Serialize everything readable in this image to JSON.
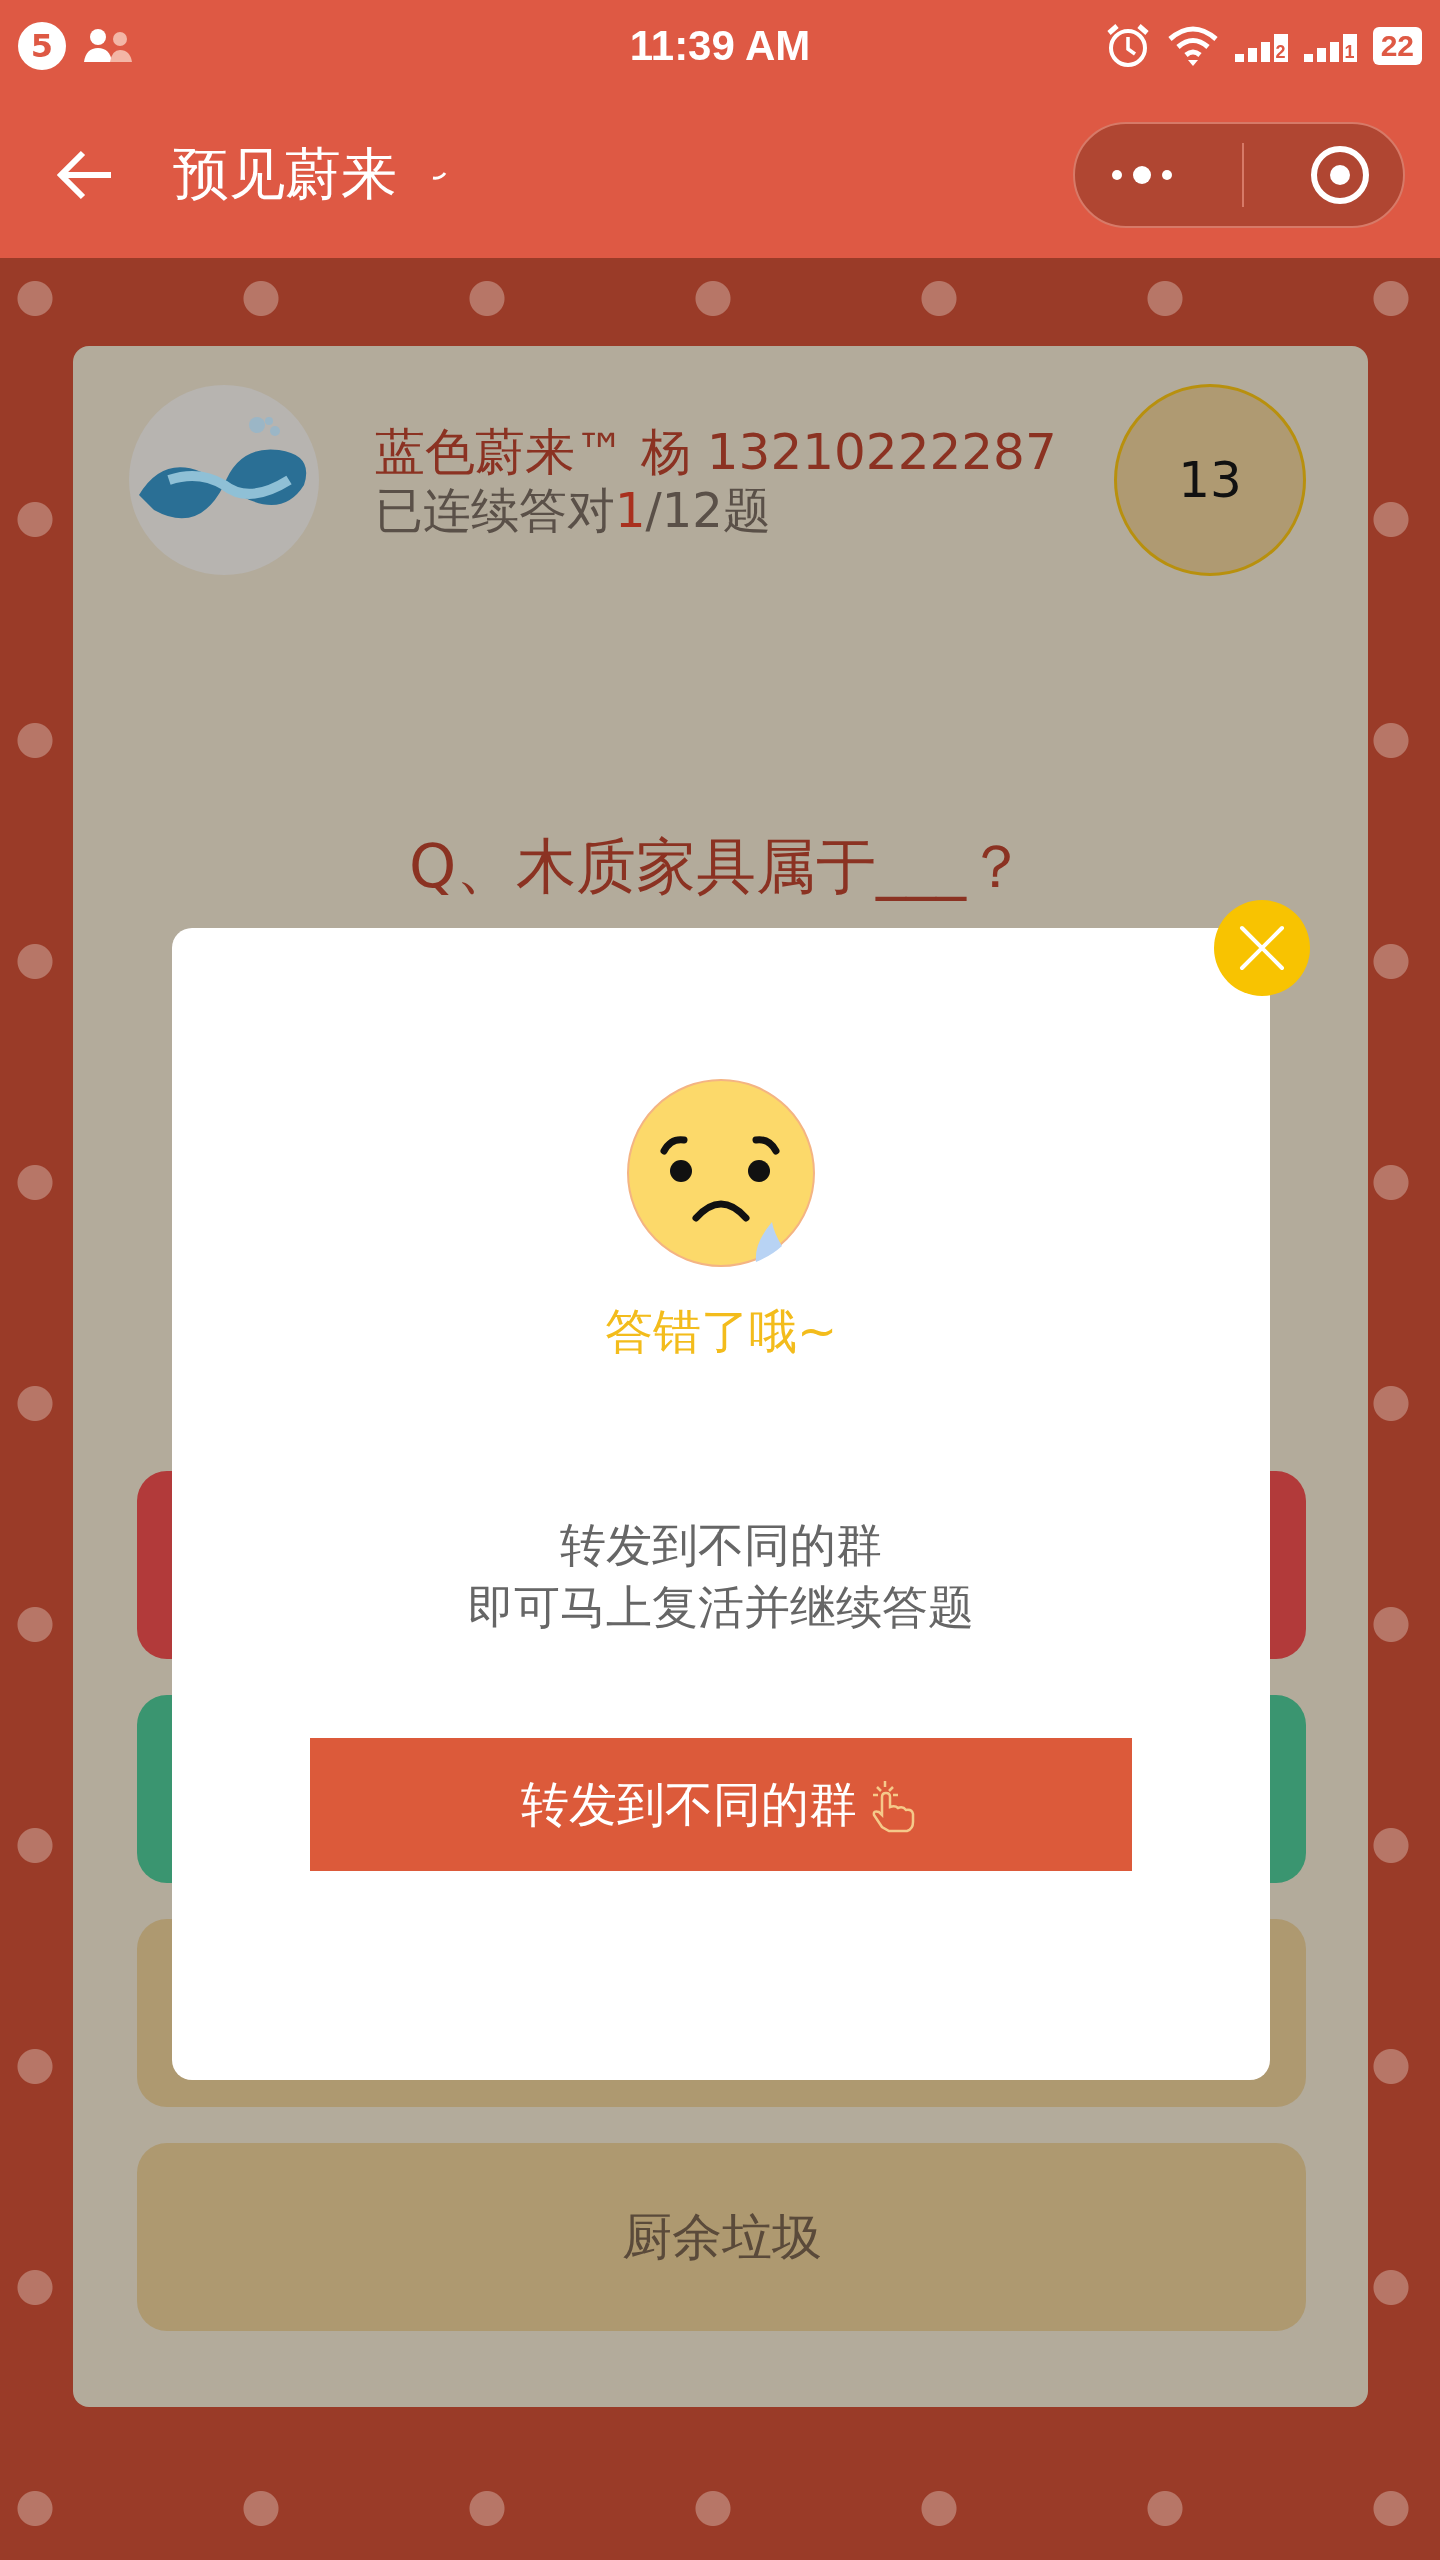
{
  "status_bar": {
    "notification_count": "5",
    "time": "11:39 AM",
    "sim_badges": [
      "2",
      "1"
    ],
    "battery": "22"
  },
  "nav_bar": {
    "title": "预见蔚来"
  },
  "player": {
    "name": "蓝色蔚来™ 杨 13210222287",
    "streak_prefix": "已连续答对",
    "streak_done": "1",
    "streak_total": "/12题",
    "score": "13"
  },
  "question": "Q、木质家具属于___？",
  "options": [
    {
      "color": "#b23a3a"
    },
    {
      "color": "#3a9570"
    },
    {
      "color": "#ae9970"
    },
    {
      "label": "厨余垃圾",
      "color": "#ae9970"
    }
  ],
  "dialog": {
    "result": "答错了哦~",
    "lines": [
      "转发到不同的群",
      "即可马上复活并继续答题"
    ],
    "button": "转发到不同的群"
  }
}
